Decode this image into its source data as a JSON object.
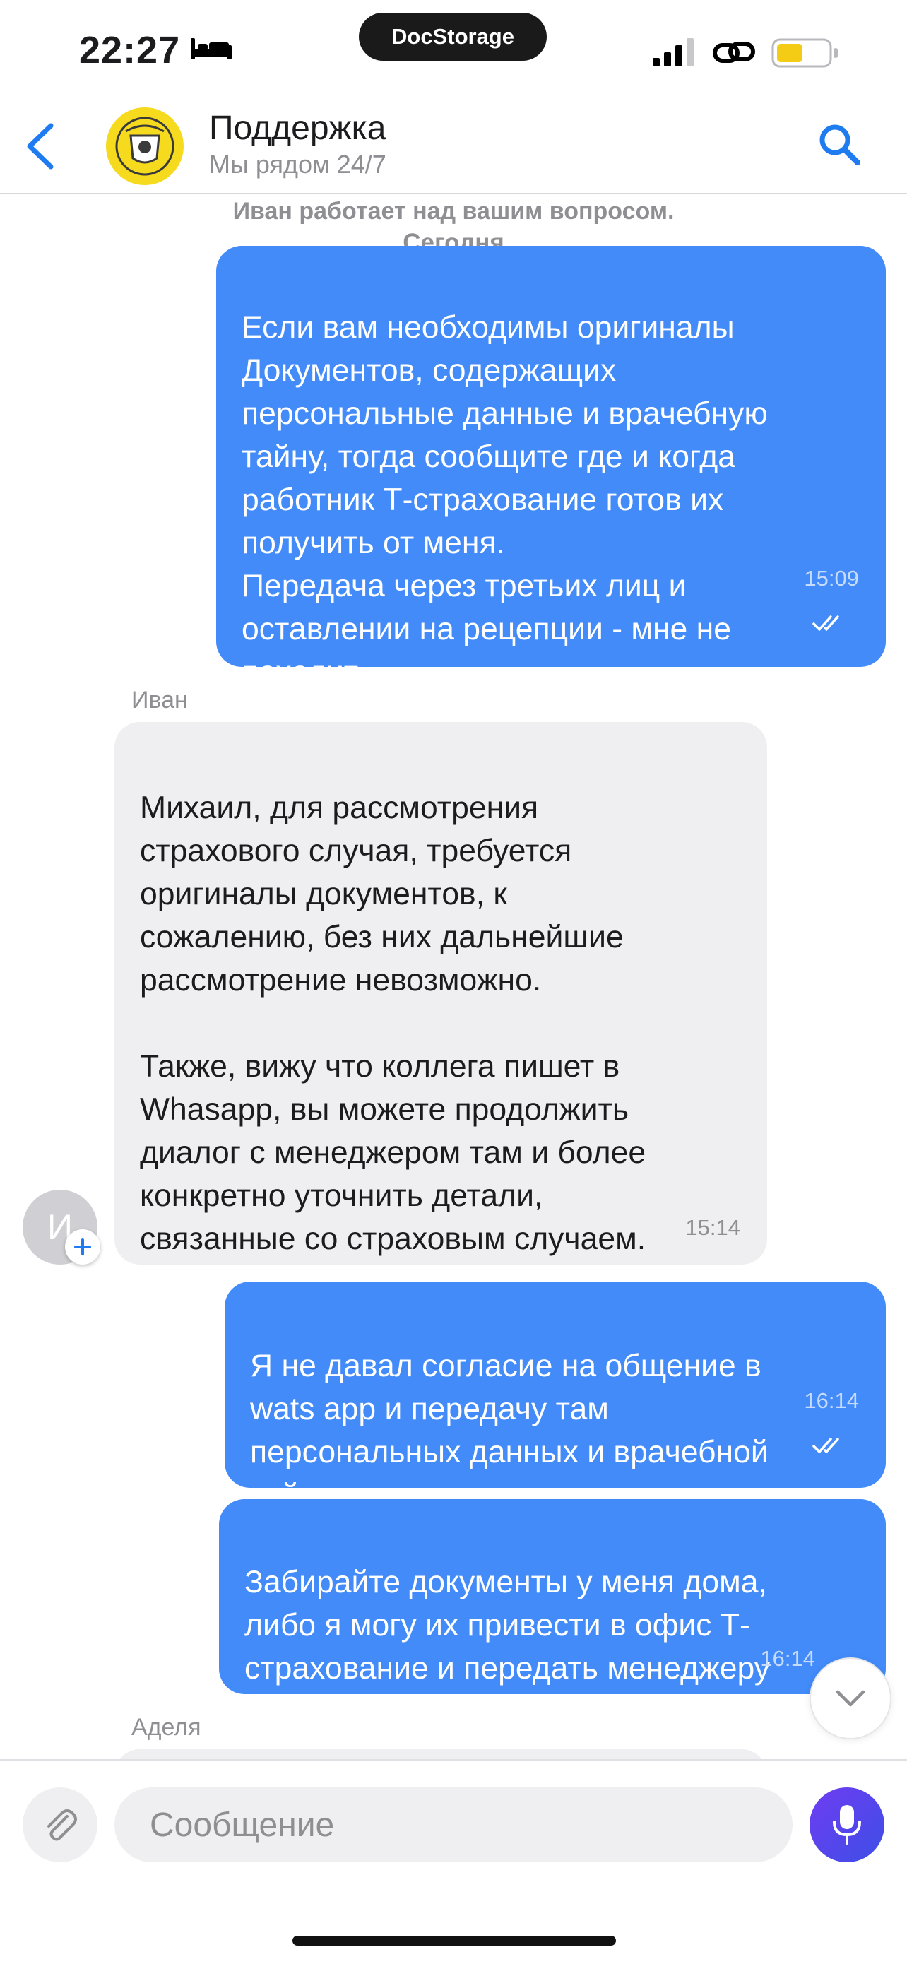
{
  "status_bar": {
    "time": "22:27",
    "island_label": "DocStorage"
  },
  "header": {
    "title": "Поддержка",
    "subtitle": "Мы рядом 24/7"
  },
  "chat": {
    "system_note": "Иван работает над вашим вопросом.",
    "date_label": "Сегодня",
    "messages": [
      {
        "text": "Если вам необходимы оригиналы\nДокументов, содержащих\nперсональные данные и врачебную\nтайну, тогда сообщите где и когда\nработник Т-страхование готов их\nполучить от меня.\nПередача через третьих лиц и\nоставлении на рецепции - мне не\nпоходит.",
        "time": "15:09"
      },
      {
        "sender": "Иван",
        "text": "Михаил, для рассмотрения\nстрахового случая, требуется\nоригиналы документов, к\nсожалению, без них дальнейшие\nрассмотрение невозможно.\n\nТакже, вижу что коллега пишет в\nWhasapp, вы можете продолжить\nдиалог с менеджером там и более\nконкретно уточнить детали,\nсвязанные со страховым случаем.",
        "time": "15:14"
      },
      {
        "text": "Я не давал согласие на общение в\nwats app и передачу там\nперсональных данных и врачебной\nтайны",
        "time": "16:14"
      },
      {
        "text": "Забирайте документы у меня дома,\nлибо я могу их привести в офис Т-\nстрахование и передать менеджеру",
        "time": "16:14"
      }
    ],
    "next_sender": "Аделя",
    "avatar_initial": "И"
  },
  "composer": {
    "placeholder": "Сообщение"
  },
  "colors": {
    "outgoing": "#428bf9",
    "incoming": "#efeff1",
    "accent": "#1f7cf0",
    "mic_gradient": [
      "#6f3cf2",
      "#3d4fe6"
    ]
  },
  "icons": [
    "bed-icon",
    "signal-icon",
    "link-icon",
    "battery-icon",
    "back-arrow-icon",
    "tinkoff-logo",
    "search-icon",
    "double-check-icon",
    "plus-icon",
    "chevron-down-icon",
    "paperclip-icon",
    "microphone-icon"
  ]
}
